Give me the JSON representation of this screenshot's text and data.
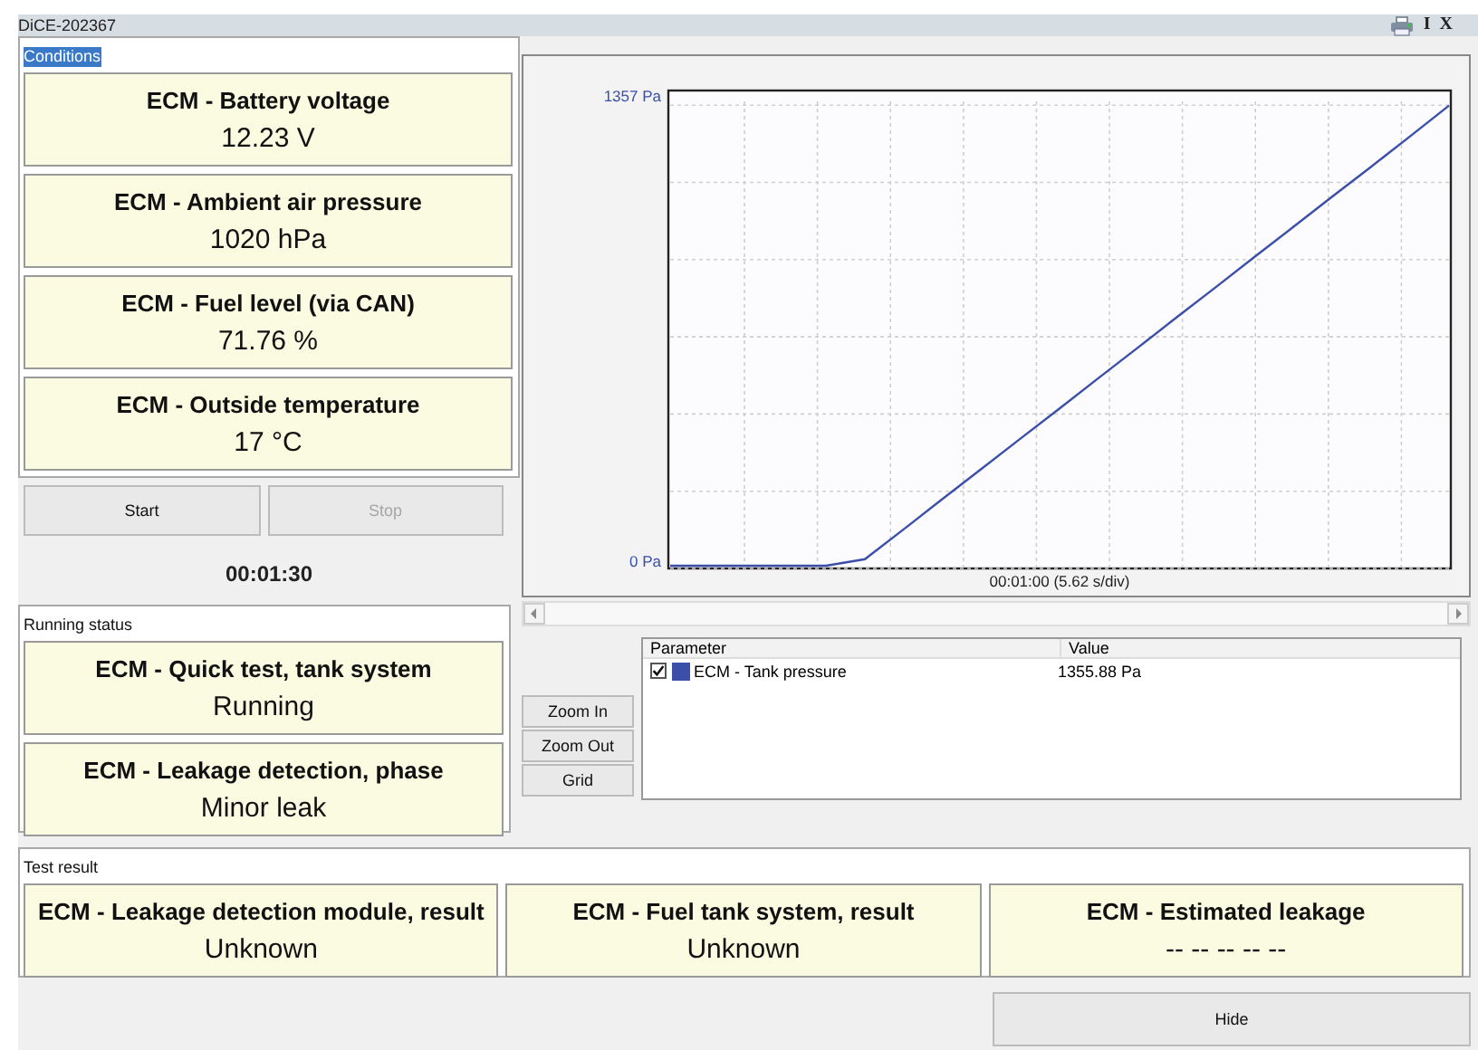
{
  "window": {
    "title": "DiCE-202367",
    "title_buttons": [
      "I",
      "X"
    ]
  },
  "conditions": {
    "label": "Conditions",
    "focused": true,
    "cards": [
      {
        "title": "ECM - Battery voltage",
        "value": "12.23 V"
      },
      {
        "title": "ECM - Ambient air pressure",
        "value": "1020 hPa"
      },
      {
        "title": "ECM - Fuel level (via CAN)",
        "value": "71.76 %"
      },
      {
        "title": "ECM - Outside temperature",
        "value": "17 °C"
      }
    ]
  },
  "controls": {
    "buttons": [
      {
        "label": "Start",
        "disabled": false
      },
      {
        "label": "Stop",
        "disabled": true
      }
    ],
    "timer": "00:01:30"
  },
  "running_status": {
    "label": "Running status",
    "focused": false,
    "cards": [
      {
        "title": "ECM - Quick test, tank system",
        "value": "Running"
      },
      {
        "title": "ECM - Leakage detection, phase",
        "value": "Minor leak"
      }
    ]
  },
  "chart": {
    "chart_data": {
      "type": "line",
      "xlabel": "00:01:00 (5.62 s/div)",
      "ylim": [
        0,
        1400
      ],
      "yticks": [
        {
          "value": 0,
          "label": "0 Pa"
        },
        {
          "value": 1357,
          "label": "1357 Pa"
        }
      ],
      "series": [
        {
          "color": "#3b4fa8",
          "values": [
            0,
            0,
            0,
            0,
            0,
            27,
            115,
            204,
            292,
            381,
            469,
            558,
            646,
            735,
            823,
            912,
            1000,
            1089,
            1177,
            1266,
            1356
          ]
        }
      ]
    }
  },
  "zoom_buttons": [
    "Zoom In",
    "Zoom Out",
    "Grid"
  ],
  "parameter_table": {
    "columns": [
      "Parameter",
      "Value"
    ],
    "rows": [
      {
        "parameter": "ECM - Tank pressure",
        "value": "1355.88 Pa",
        "checked": true,
        "color": "#3b4fa8"
      }
    ]
  },
  "test_result": {
    "label": "Test result",
    "focused": false,
    "cards": [
      {
        "title": "ECM - Leakage detection module, result",
        "value": "Unknown"
      },
      {
        "title": "ECM - Fuel tank system, result",
        "value": "Unknown"
      },
      {
        "title": "ECM - Estimated leakage",
        "value": "-- -- -- -- --"
      }
    ]
  },
  "hide_button": "Hide"
}
